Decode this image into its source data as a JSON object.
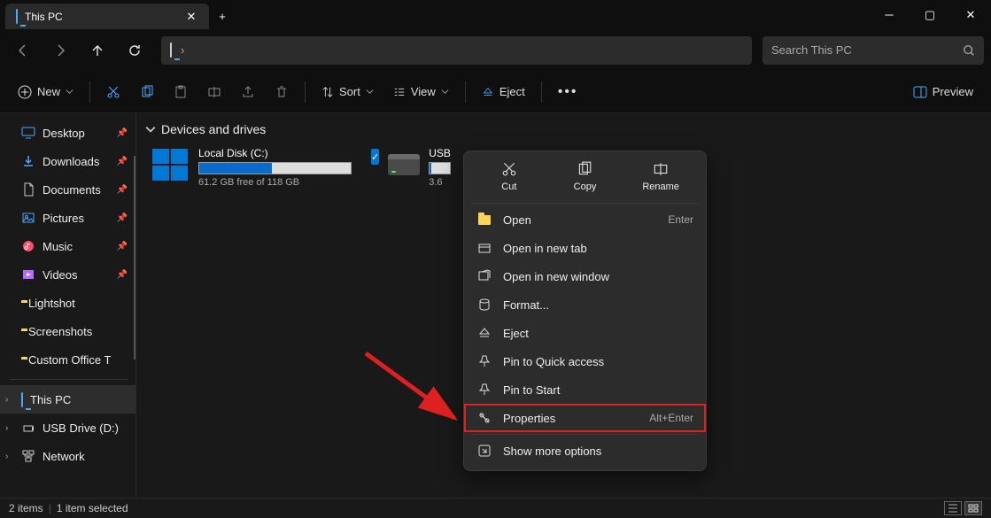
{
  "titlebar": {
    "tab_title": "This PC",
    "close_glyph": "✕",
    "new_tab_glyph": "+",
    "min_glyph": "─",
    "max_glyph": "▢"
  },
  "nav": {
    "back": "←",
    "forward": "→",
    "up": "↑",
    "refresh": "⟳",
    "breadcrumb_chevron": "›"
  },
  "toolbar": {
    "new_label": "New",
    "sort_label": "Sort",
    "view_label": "View",
    "eject_label": "Eject",
    "preview_label": "Preview"
  },
  "sidebar": {
    "items": [
      {
        "label": "Desktop",
        "icon": "desktop",
        "color": "#4aa8ff",
        "pinned": true
      },
      {
        "label": "Downloads",
        "icon": "download",
        "color": "#4aa8ff",
        "pinned": true
      },
      {
        "label": "Documents",
        "icon": "document",
        "color": "#cccccc",
        "pinned": true
      },
      {
        "label": "Pictures",
        "icon": "pictures",
        "color": "#4aa8ff",
        "pinned": true
      },
      {
        "label": "Music",
        "icon": "music",
        "color": "#ff4a6a",
        "pinned": true
      },
      {
        "label": "Videos",
        "icon": "videos",
        "color": "#b56bff",
        "pinned": true
      },
      {
        "label": "Lightshot",
        "icon": "folder",
        "color": "#ffd659",
        "pinned": false
      },
      {
        "label": "Screenshots",
        "icon": "folder",
        "color": "#ffd659",
        "pinned": false
      },
      {
        "label": "Custom Office T",
        "icon": "folder",
        "color": "#ffd659",
        "pinned": false
      }
    ],
    "tree": [
      {
        "label": "This PC",
        "icon": "monitor",
        "active": true,
        "expanded": false
      },
      {
        "label": "USB Drive (D:)",
        "icon": "usb",
        "active": false,
        "expanded": false
      },
      {
        "label": "Network",
        "icon": "network",
        "active": false,
        "expanded": false
      }
    ]
  },
  "section": {
    "header": "Devices and drives"
  },
  "drives": [
    {
      "name": "Local Disk (C:)",
      "free_text": "61.2 GB free of 118 GB",
      "fill_percent": 48,
      "icon": "windisk",
      "selected": false
    },
    {
      "name": "USB",
      "free_text": "3.6",
      "fill_percent": 6,
      "icon": "drive",
      "selected": true
    }
  ],
  "context_menu": {
    "top": [
      {
        "label": "Cut",
        "icon": "cut"
      },
      {
        "label": "Copy",
        "icon": "copy"
      },
      {
        "label": "Rename",
        "icon": "rename"
      }
    ],
    "items": [
      {
        "label": "Open",
        "icon": "folder-sm",
        "shortcut": "Enter"
      },
      {
        "label": "Open in new tab",
        "icon": "tab"
      },
      {
        "label": "Open in new window",
        "icon": "window"
      },
      {
        "label": "Format...",
        "icon": "format"
      },
      {
        "label": "Eject",
        "icon": "eject"
      },
      {
        "label": "Pin to Quick access",
        "icon": "pin"
      },
      {
        "label": "Pin to Start",
        "icon": "pin-start"
      },
      {
        "label": "Properties",
        "icon": "properties",
        "shortcut": "Alt+Enter",
        "highlighted": true
      },
      {
        "label": "Show more options",
        "icon": "more"
      }
    ]
  },
  "search": {
    "placeholder": "Search This PC"
  },
  "statusbar": {
    "items_text": "2 items",
    "selected_text": "1 item selected"
  }
}
